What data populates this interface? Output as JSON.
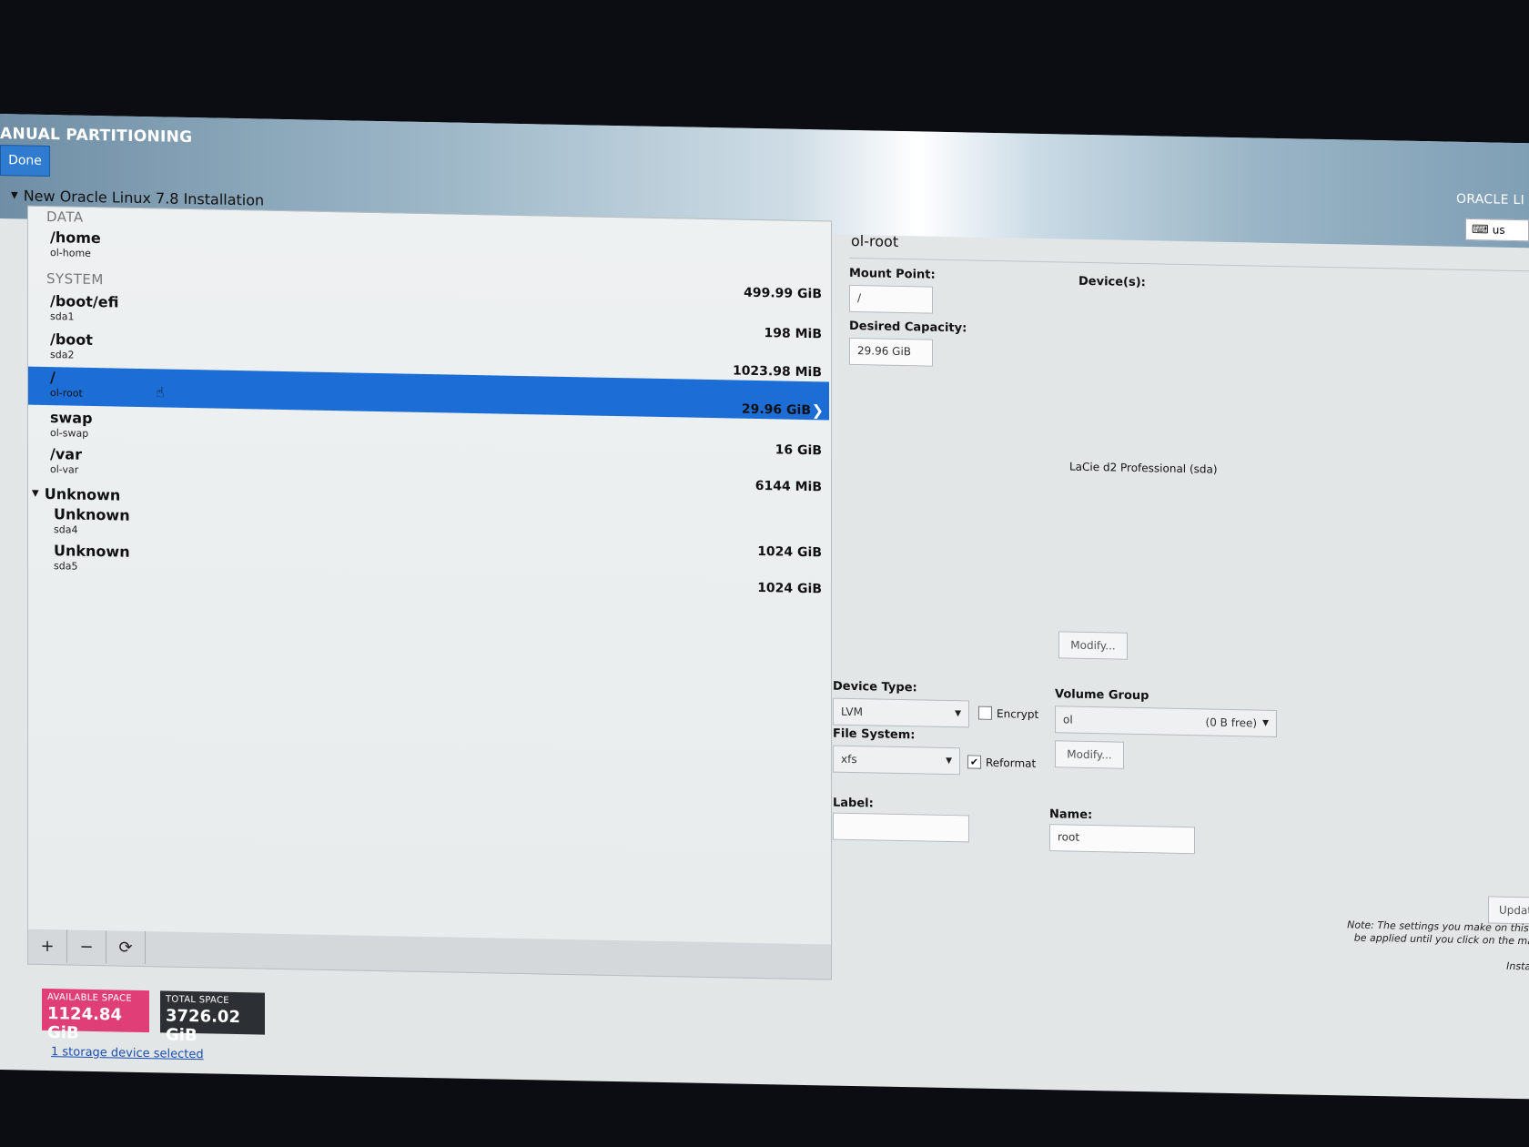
{
  "header": {
    "title": "ANUAL PARTITIONING",
    "done_label": "Done",
    "brand": "ORACLE LI",
    "keyboard_layout": "us"
  },
  "tree": {
    "installation_title": "New Oracle Linux 7.8 Installation",
    "sections": [
      {
        "name": "DATA"
      },
      {
        "name": "SYSTEM"
      }
    ],
    "rows": [
      {
        "mount": "/home",
        "device": "ol-home",
        "size": "499.99 GiB"
      },
      {
        "mount": "/boot/efi",
        "device": "sda1",
        "size": "198 MiB"
      },
      {
        "mount": "/boot",
        "device": "sda2",
        "size": "1023.98 MiB"
      },
      {
        "mount": "/",
        "device": "ol-root",
        "size": "29.96 GiB"
      },
      {
        "mount": "swap",
        "device": "ol-swap",
        "size": "16 GiB"
      },
      {
        "mount": "/var",
        "device": "ol-var",
        "size": "6144 MiB"
      },
      {
        "mount": "Unknown",
        "device": "sda4",
        "size": "1024 GiB"
      },
      {
        "mount": "Unknown",
        "device": "sda5",
        "size": "1024 GiB"
      }
    ],
    "unknown_group": "Unknown"
  },
  "toolbar": {
    "add": "+",
    "remove": "−",
    "refresh": "⟳"
  },
  "space": {
    "available_label": "AVAILABLE SPACE",
    "available_value": "1124.84 GiB",
    "total_label": "TOTAL SPACE",
    "total_value": "3726.02 GiB"
  },
  "storage_link": "1 storage device selected",
  "detail": {
    "title": "ol-root",
    "mount_point_label": "Mount Point:",
    "mount_point_value": "/",
    "desired_capacity_label": "Desired Capacity:",
    "desired_capacity_value": "29.96 GiB",
    "devices_label": "Device(s):",
    "device_name": "LaCie d2 Professional (sda)",
    "modify_label": "Modify...",
    "device_type_label": "Device Type:",
    "device_type_value": "LVM",
    "encrypt_label": "Encrypt",
    "volume_group_label": "Volume Group",
    "volume_group_value": "ol",
    "volume_group_free": "(0 B free)",
    "vg_modify_label": "Modify...",
    "file_system_label": "File System:",
    "file_system_value": "xfs",
    "reformat_label": "Reformat",
    "label_label": "Label:",
    "label_value": "",
    "name_label": "Name:",
    "name_value": "root",
    "update_label": "Updat",
    "note_line1": "Note:  The settings you make on this sc",
    "note_line2": "be applied until you click on the main m",
    "note_line3": "Installa"
  }
}
